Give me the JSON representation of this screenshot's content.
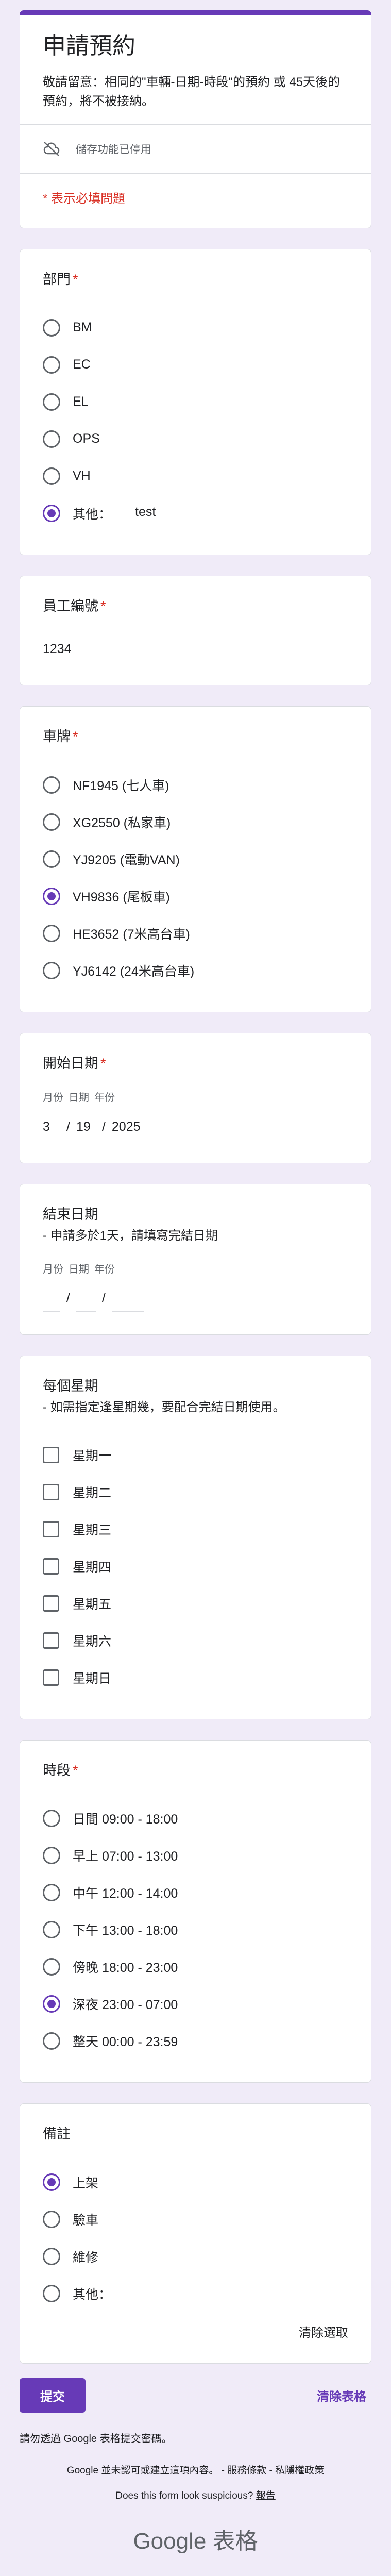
{
  "header": {
    "title": "申請預約",
    "description": "敬請留意：相同的\"車輛-日期-時段\"的預約 或 45天後的預約，將不被接納。",
    "saving_disabled": "儲存功能已停用",
    "required_note": "* 表示必填問題"
  },
  "department": {
    "title": "部門",
    "required_mark": "*",
    "options": [
      "BM",
      "EC",
      "EL",
      "OPS",
      "VH"
    ],
    "other_label": "其他：",
    "other_value": "test",
    "selected": "other"
  },
  "employee": {
    "title": "員工編號",
    "required_mark": "*",
    "value": "1234"
  },
  "plate": {
    "title": "車牌",
    "required_mark": "*",
    "options": [
      "NF1945 (七人車)",
      "XG2550 (私家車)",
      "YJ9205 (電動VAN)",
      "VH9836 (尾板車)",
      "HE3652 (7米高台車)",
      "YJ6142 (24米高台車)"
    ],
    "selected_index": 3
  },
  "start_date": {
    "title": "開始日期",
    "required_mark": "*",
    "labels": {
      "month": "月份",
      "day": "日期",
      "year": "年份"
    },
    "month": "3",
    "day": "19",
    "year": "2025"
  },
  "end_date": {
    "title": "結束日期",
    "description": "- 申請多於1天，請填寫完結日期",
    "labels": {
      "month": "月份",
      "day": "日期",
      "year": "年份"
    },
    "month": "",
    "day": "",
    "year": ""
  },
  "weekdays": {
    "title": "每個星期",
    "description": "- 如需指定逢星期幾，要配合完結日期使用。",
    "options": [
      "星期一",
      "星期二",
      "星期三",
      "星期四",
      "星期五",
      "星期六",
      "星期日"
    ]
  },
  "timeslot": {
    "title": "時段",
    "required_mark": "*",
    "options": [
      "日間 09:00 - 18:00",
      "早上 07:00 - 13:00",
      "中午 12:00 - 14:00",
      "下午 13:00 - 18:00",
      "傍晚 18:00 - 23:00",
      "深夜 23:00 - 07:00",
      "整天 00:00 - 23:59"
    ],
    "selected_index": 5
  },
  "remarks": {
    "title": "備註",
    "options": [
      "上架",
      "驗車",
      "維修"
    ],
    "other_label": "其他：",
    "other_value": "",
    "selected_index": 0,
    "clear_selection": "清除選取"
  },
  "actions": {
    "submit": "提交",
    "clear_form": "清除表格"
  },
  "footer": {
    "password_note": "請勿透過 Google 表格提交密碼。",
    "disclaimer_prefix": "Google 並未認可或建立這項內容。 -",
    "terms": "服務條款",
    "separator": " - ",
    "privacy": "私隱權政策",
    "suspicious_prefix": "Does this form look suspicious?",
    "report": "報告",
    "brand": "Google 表格"
  },
  "colors": {
    "accent": "#673ab7",
    "background": "#f0ebf8",
    "required": "#d93025"
  }
}
